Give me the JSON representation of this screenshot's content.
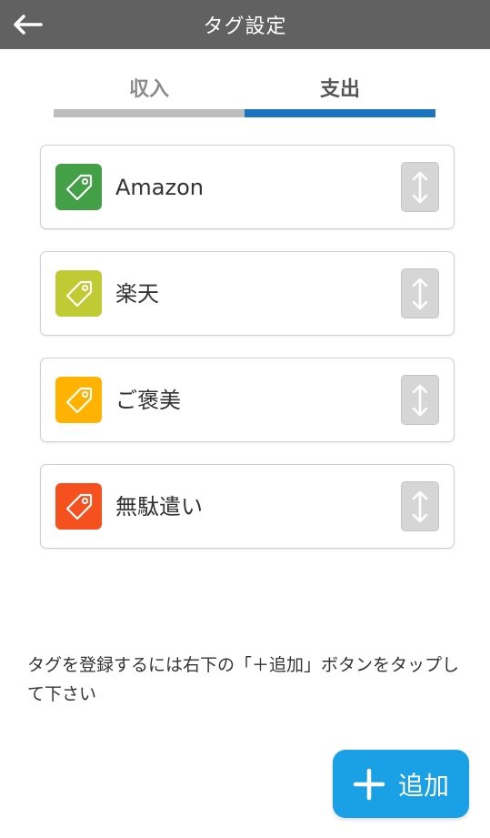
{
  "header": {
    "title": "タグ設定",
    "back_icon": "arrow-left-icon"
  },
  "tabs": [
    {
      "label": "収入",
      "selected": false
    },
    {
      "label": "支出",
      "selected": true
    }
  ],
  "tags": [
    {
      "name": "Amazon",
      "color": "#43a047",
      "icon": "tag-icon"
    },
    {
      "name": "楽天",
      "color": "#c0ca33",
      "icon": "tag-icon"
    },
    {
      "name": "ご褒美",
      "color": "#ffb300",
      "icon": "tag-icon"
    },
    {
      "name": "無駄遣い",
      "color": "#f4511e",
      "icon": "tag-icon"
    }
  ],
  "hint": "タグを登録するには右下の「＋追加」ボタンをタップして下さい",
  "add_button": {
    "label": "追加",
    "icon": "plus-icon"
  },
  "colors": {
    "header_bg": "#616161",
    "tab_active": "#1a74c0",
    "tab_inactive": "#bdbdbd",
    "add_button_bg": "#1aa0e4"
  }
}
